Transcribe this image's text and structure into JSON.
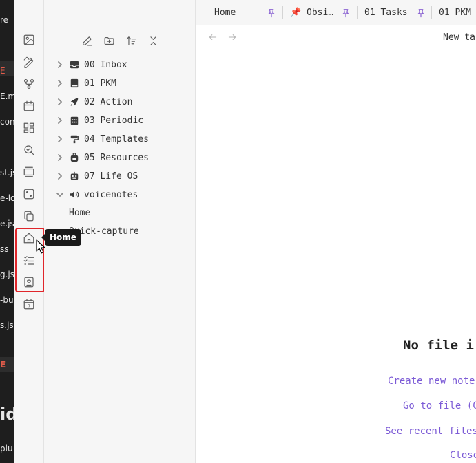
{
  "background_window": {
    "snippets": [
      "re",
      "E",
      "E.m",
      "con",
      "st.js",
      "e-lo",
      "e.js",
      "ss",
      "g.js",
      "-bur",
      "s.js",
      "E",
      "id",
      "plu"
    ]
  },
  "ribbon": {
    "items": [
      {
        "icon": "image-icon"
      },
      {
        "icon": "pencil-ruler-icon"
      },
      {
        "icon": "git-fork-icon"
      },
      {
        "icon": "calendar-icon"
      },
      {
        "icon": "dashboard-icon"
      },
      {
        "icon": "search-check-icon"
      },
      {
        "icon": "slides-icon"
      },
      {
        "icon": "dice-icon"
      },
      {
        "icon": "copy-icon"
      },
      {
        "icon": "home-icon"
      },
      {
        "icon": "checklist-icon"
      },
      {
        "icon": "heart-box-icon"
      },
      {
        "icon": "calendar-7-icon"
      }
    ],
    "tooltip": "Home",
    "highlight_color": "#e0262b"
  },
  "sidebar": {
    "top_buttons": [
      {
        "icon": "sidebar-toggle-icon"
      },
      {
        "icon": "folder-icon",
        "active": true
      },
      {
        "icon": "bookmark-icon"
      }
    ],
    "nav_buttons": [
      {
        "icon": "new-note-icon"
      },
      {
        "icon": "new-folder-icon"
      },
      {
        "icon": "sort-icon"
      },
      {
        "icon": "collapse-icon"
      }
    ],
    "folders": [
      {
        "label": "00 Inbox",
        "icon": "inbox-icon",
        "expanded": false
      },
      {
        "label": "01 PKM",
        "icon": "book-icon",
        "expanded": false
      },
      {
        "label": "02 Action",
        "icon": "rocket-icon",
        "expanded": false
      },
      {
        "label": "03 Periodic",
        "icon": "calendar-grid-icon",
        "expanded": false
      },
      {
        "label": "04 Templates",
        "icon": "paint-roller-icon",
        "expanded": false
      },
      {
        "label": "05 Resources",
        "icon": "backpack-icon",
        "expanded": false
      },
      {
        "label": "07 Life OS",
        "icon": "robot-icon",
        "expanded": false
      },
      {
        "label": "voicenotes",
        "icon": "speaker-icon",
        "expanded": true
      }
    ],
    "files": [
      "Home",
      "Quick-capture"
    ]
  },
  "tabs": [
    {
      "label": "Home",
      "pinned": true
    },
    {
      "label": "📌 Obsi…",
      "pinned": true
    },
    {
      "label": "01 Tasks",
      "pinned": true
    },
    {
      "label": "01 PKM",
      "pinned": false
    }
  ],
  "main": {
    "title": "New ta",
    "empty_state": {
      "heading": "No file i",
      "actions": [
        "Create new note",
        "Go to file (C",
        "See recent files",
        "Close"
      ]
    }
  },
  "colors": {
    "accent": "#7c5bd6",
    "pin": "#8a63d2"
  }
}
